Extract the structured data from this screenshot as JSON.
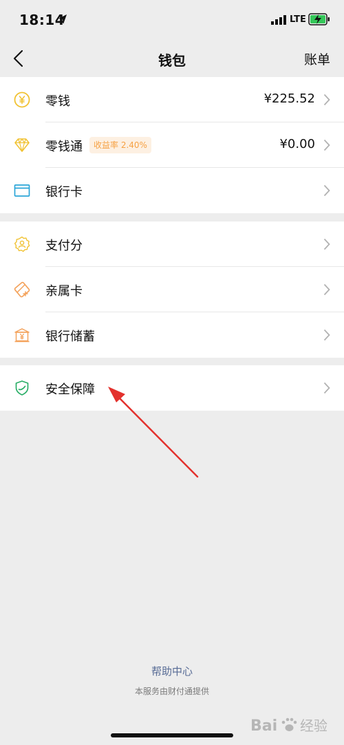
{
  "status_bar": {
    "time": "18:14",
    "network": "LTE"
  },
  "nav": {
    "title": "钱包",
    "right_action": "账单"
  },
  "groups": [
    [
      {
        "label": "零钱",
        "value": "¥225.52",
        "icon": "yen-coin-icon"
      },
      {
        "label": "零钱通",
        "badge": "收益率 2.40%",
        "value": "¥0.00",
        "icon": "diamond-icon"
      },
      {
        "label": "银行卡",
        "icon": "bank-card-icon"
      }
    ],
    [
      {
        "label": "支付分",
        "icon": "payment-score-icon"
      },
      {
        "label": "亲属卡",
        "icon": "family-card-icon"
      },
      {
        "label": "银行储蓄",
        "icon": "bank-savings-icon"
      }
    ],
    [
      {
        "label": "安全保障",
        "icon": "shield-icon"
      }
    ]
  ],
  "footer": {
    "help_link": "帮助中心",
    "provider_note": "本服务由财付通提供"
  },
  "watermark": "Bai 经验",
  "colors": {
    "background": "#ededed",
    "yellow_icon": "#f1c232",
    "orange_icon": "#f4a25b",
    "blue_icon": "#2aa5d8",
    "green_icon": "#2aae67",
    "badge_text": "#f6a144",
    "link_blue": "#576b95",
    "annotation_red": "#e3312d"
  }
}
